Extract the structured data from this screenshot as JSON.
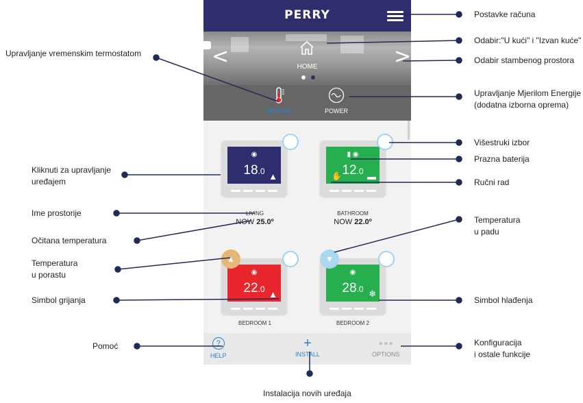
{
  "app": {
    "logo": "PERRY"
  },
  "hero": {
    "label": "HOME",
    "prev": "<",
    "next": ">"
  },
  "modes": [
    {
      "label": "HEATING"
    },
    {
      "label": "POWER"
    }
  ],
  "devices": [
    {
      "room": "LIVING",
      "now_prefix": "NOW",
      "now_value": "25.0º",
      "temp_int": "18",
      "temp_dec": ".0",
      "screen_color": "#2e2e6e",
      "symbol": "flame-icon"
    },
    {
      "room": "BATHROOM",
      "now_prefix": "NOW",
      "now_value": "22.0º",
      "temp_int": "12",
      "temp_dec": ".0",
      "screen_color": "#27ae4f",
      "symbol": "manual-icon"
    },
    {
      "room": "BEDROOM 1",
      "temp_int": "22",
      "temp_dec": ".0",
      "screen_color": "#e8262b",
      "symbol": "flame-icon",
      "trend": "rising"
    },
    {
      "room": "BEDROOM 2",
      "temp_int": "28",
      "temp_dec": ".0",
      "screen_color": "#27ae4f",
      "symbol": "snowflake-icon",
      "trend": "falling"
    }
  ],
  "tabs": [
    {
      "label": "HELP"
    },
    {
      "label": "INSTALL"
    },
    {
      "label": "OPTIONS"
    }
  ],
  "callouts": {
    "account": "Postavke računa",
    "home_away": "Odabir:\"U kući\" i \"Izvan kuće\"",
    "space": "Odabir stambenog prostora",
    "energy_1": "Upravljanje Mjerilom Energije",
    "energy_2": "(dodatna izborna oprema)",
    "multi": "Višestruki izbor",
    "battery": "Prazna baterija",
    "manual": "Ručni rad",
    "falling_1": "Temperatura",
    "falling_2": "u padu",
    "cooling": "Simbol hlađenja",
    "config_1": "Konfiguracija",
    "config_2": "i ostale funkcije",
    "install": "Instalacija novih uređaja",
    "help": "Pomoć",
    "heating_sym": "Simbol grijanja",
    "rising_1": "Temperatura",
    "rising_2": "u porastu",
    "read_temp": "Očitana temperatura",
    "room_name": "Ime prostorije",
    "click_1": "Kliknuti za upravljanje",
    "click_2": "uređajem",
    "thermostat": "Upravljanje vremenskim termostatom"
  },
  "colors": {
    "navy": "#2e2e6e",
    "accent_blue": "#2b7fd0",
    "green": "#27ae4f",
    "red": "#e8262b",
    "rising": "#e6b877",
    "falling": "#a9d8f0"
  }
}
